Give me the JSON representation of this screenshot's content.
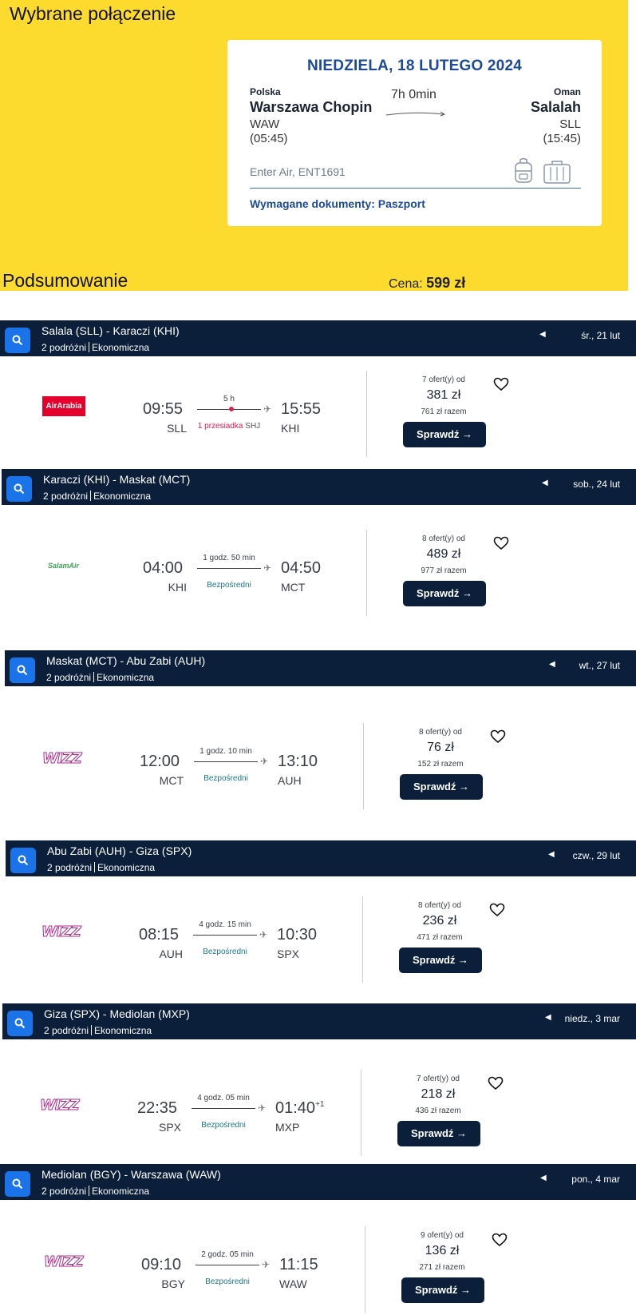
{
  "selected": {
    "title": "Wybrane połączenie",
    "date": "NIEDZIELA, 18 LUTEGO 2024",
    "from": {
      "country": "Polska",
      "city": "Warszawa Chopin",
      "code": "WAW",
      "time": "(05:45)"
    },
    "to": {
      "country": "Oman",
      "city": "Salalah",
      "code": "SLL",
      "time": "(15:45)"
    },
    "duration": "7h 0min",
    "airline": "Enter Air, ENT1691",
    "documents": "Wymagane dokumenty: Paszport",
    "icons": [
      "backpack-icon",
      "suitcase-icon"
    ]
  },
  "summary": {
    "label": "Podsumowanie",
    "price_label": "Cena:",
    "price_value": "599 zł"
  },
  "colors": {
    "yellow": "#fddb2e",
    "navy": "#0b1f3a",
    "blue": "#1c4a99",
    "search_btn": "#1a73e8"
  },
  "segments": [
    {
      "route": "Salala (SLL) - Karaczi (KHI)",
      "pax": "2 podróżni",
      "cabin": "Ekonomiczna",
      "date": "śr., 21 lut",
      "airline_logo": "AirArabia",
      "dep_time": "09:55",
      "dep_code": "SLL",
      "arr_time": "15:55",
      "arr_code": "KHI",
      "duration": "5 h",
      "stops": "1 przesiadka",
      "via": "SHJ",
      "offers": "7 ofert(y) od",
      "price": "381 zł",
      "total": "761 zł razem",
      "button": "Sprawdź →"
    },
    {
      "route": "Karaczi (KHI) - Maskat (MCT)",
      "pax": "2 podróżni",
      "cabin": "Ekonomiczna",
      "date": "sob., 24 lut",
      "airline_logo": "SalamAir",
      "dep_time": "04:00",
      "dep_code": "KHI",
      "arr_time": "04:50",
      "arr_code": "MCT",
      "duration": "1 godz. 50 min",
      "stops": "Bezpośredni",
      "offers": "8 ofert(y) od",
      "price": "489 zł",
      "total": "977 zł razem",
      "button": "Sprawdź →"
    },
    {
      "route": "Maskat (MCT) - Abu Zabi (AUH)",
      "pax": "2 podróżni",
      "cabin": "Ekonomiczna",
      "date": "wt., 27 lut",
      "airline_logo": "WIZZ",
      "dep_time": "12:00",
      "dep_code": "MCT",
      "arr_time": "13:10",
      "arr_code": "AUH",
      "duration": "1 godz. 10 min",
      "stops": "Bezpośredni",
      "offers": "8 ofert(y) od",
      "price": "76 zł",
      "total": "152 zł razem",
      "button": "Sprawdź →"
    },
    {
      "route": "Abu Zabi (AUH) - Giza (SPX)",
      "pax": "2 podróżni",
      "cabin": "Ekonomiczna",
      "date": "czw., 29 lut",
      "airline_logo": "WIZZ",
      "dep_time": "08:15",
      "dep_code": "AUH",
      "arr_time": "10:30",
      "arr_code": "SPX",
      "duration": "4 godz. 15 min",
      "stops": "Bezpośredni",
      "offers": "8 ofert(y) od",
      "price": "236 zł",
      "total": "471 zł razem",
      "button": "Sprawdź →"
    },
    {
      "route": "Giza (SPX) - Mediolan (MXP)",
      "pax": "2 podróżni",
      "cabin": "Ekonomiczna",
      "date": "niedz., 3 mar",
      "airline_logo": "WIZZ",
      "dep_time": "22:35",
      "dep_code": "SPX",
      "arr_time": "01:40",
      "arr_day": "+1",
      "arr_code": "MXP",
      "duration": "4 godz. 05 min",
      "stops": "Bezpośredni",
      "offers": "7 ofert(y) od",
      "price": "218 zł",
      "total": "436 zł razem",
      "button": "Sprawdź →"
    },
    {
      "route": "Mediolan (BGY) - Warszawa (WAW)",
      "pax": "2 podróżni",
      "cabin": "Ekonomiczna",
      "date": "pon., 4 mar",
      "airline_logo": "WIZZ",
      "dep_time": "09:10",
      "dep_code": "BGY",
      "arr_time": "11:15",
      "arr_code": "WAW",
      "duration": "2 godz. 05 min",
      "stops": "Bezpośredni",
      "offers": "9 ofert(y) od",
      "price": "136 zł",
      "total": "271 zł razem",
      "button": "Sprawdź →"
    }
  ]
}
